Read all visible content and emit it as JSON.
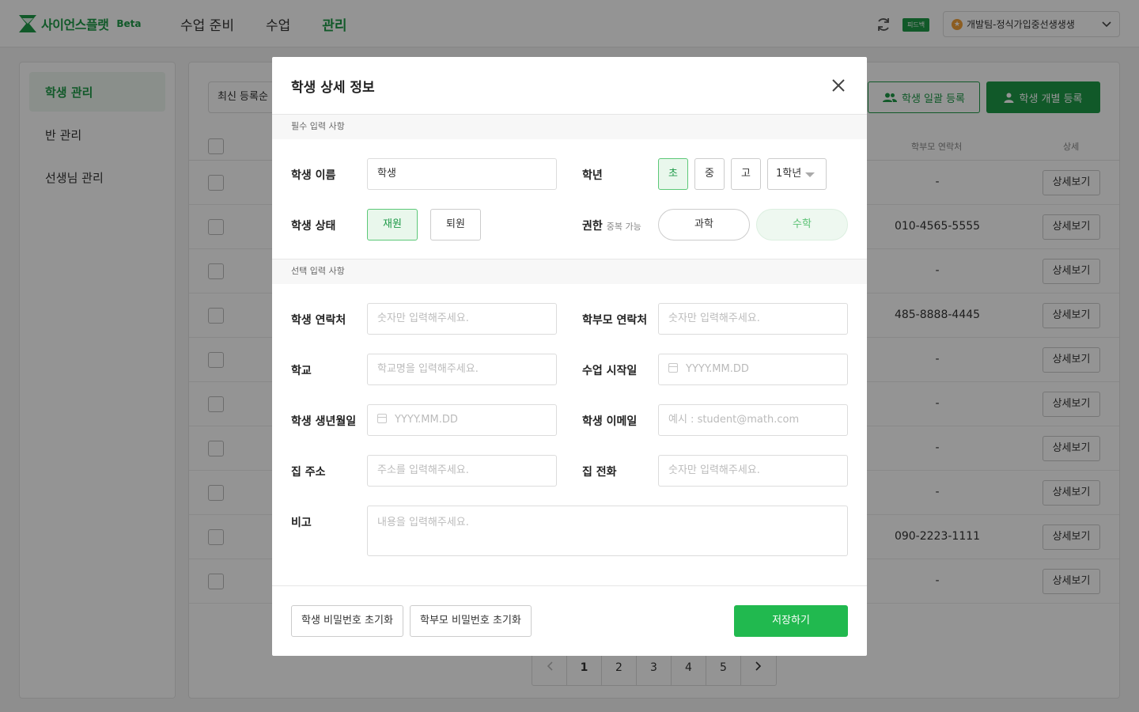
{
  "header": {
    "logo_text": "사이언스플랫",
    "logo_badge": "Beta",
    "nav": [
      {
        "label": "수업 준비"
      },
      {
        "label": "수업"
      },
      {
        "label": "관리"
      }
    ],
    "feedback_label": "피드백",
    "user_label": "개발팀-정식가입중선생생생"
  },
  "sidebar": {
    "items": [
      {
        "label": "학생 관리"
      },
      {
        "label": "반 관리"
      },
      {
        "label": "선생님 관리"
      }
    ]
  },
  "content": {
    "sort_value": "최신 등록순",
    "bulk_register_label": "학생 일괄 등록",
    "single_register_label": "학생 개별 등록",
    "columns": {
      "parent_phone": "학부모 연락처",
      "detail": "상세"
    },
    "rows": [
      {
        "parent_phone": "-",
        "detail_label": "상세보기"
      },
      {
        "parent_phone": "010-4565-5555",
        "detail_label": "상세보기"
      },
      {
        "parent_phone": "-",
        "detail_label": "상세보기"
      },
      {
        "parent_phone": "485-8888-4445",
        "detail_label": "상세보기"
      },
      {
        "parent_phone": "-",
        "detail_label": "상세보기"
      },
      {
        "parent_phone": "-",
        "detail_label": "상세보기"
      },
      {
        "parent_phone": "-",
        "detail_label": "상세보기"
      },
      {
        "parent_phone": "-",
        "detail_label": "상세보기"
      },
      {
        "parent_phone": "090-2223-1111",
        "detail_label": "상세보기"
      },
      {
        "parent_phone": "-",
        "detail_label": "상세보기"
      }
    ],
    "pagination": {
      "pages": [
        "1",
        "2",
        "3",
        "4",
        "5"
      ],
      "current": "1"
    }
  },
  "modal": {
    "title": "학생 상세 정보",
    "required_section": "필수 입력 사항",
    "optional_section": "선택 입력 사항",
    "name": {
      "label": "학생 이름",
      "value": "학생"
    },
    "grade": {
      "label": "학년",
      "levels": [
        "초",
        "중",
        "고"
      ],
      "selected_level": "초",
      "year_value": "1학년"
    },
    "status": {
      "label": "학생 상태",
      "options": [
        "재원",
        "퇴원"
      ],
      "selected": "재원"
    },
    "permission": {
      "label": "권한",
      "note": "중복 가능",
      "options": [
        "과학",
        "수학"
      ],
      "selected": "수학"
    },
    "student_phone": {
      "label": "학생 연락처",
      "placeholder": "숫자만 입력해주세요."
    },
    "parent_phone": {
      "label": "학부모 연락처",
      "placeholder": "숫자만 입력해주세요."
    },
    "school": {
      "label": "학교",
      "placeholder": "학교명을 입력해주세요."
    },
    "class_start": {
      "label": "수업 시작일",
      "placeholder": "YYYY.MM.DD"
    },
    "birthday": {
      "label": "학생 생년월일",
      "placeholder": "YYYY.MM.DD"
    },
    "email": {
      "label": "학생 이메일",
      "placeholder": "예시 : student@math.com"
    },
    "address": {
      "label": "집 주소",
      "placeholder": "주소를 입력해주세요."
    },
    "home_phone": {
      "label": "집 전화",
      "placeholder": "숫자만 입력해주세요."
    },
    "memo": {
      "label": "비고",
      "placeholder": "내용을 입력해주세요."
    },
    "reset_student_pw_label": "학생 비밀번호 초기화",
    "reset_parent_pw_label": "학부모 비밀번호 초기화",
    "save_label": "저장하기"
  },
  "colors": {
    "brand_green": "#1e9a48",
    "save_green": "#21b94f",
    "overlay": "rgba(0,0,0,0.42)"
  }
}
